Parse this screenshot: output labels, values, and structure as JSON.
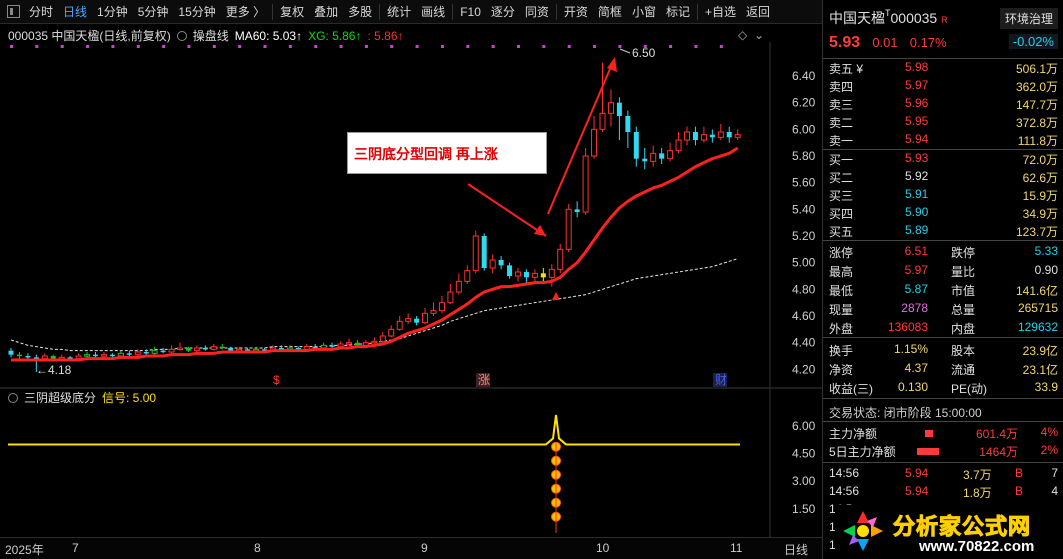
{
  "toolbar": {
    "items": [
      "分时",
      "日线",
      "1分钟",
      "5分钟",
      "15分钟",
      "更多 〉",
      "复权",
      "叠加",
      "多股",
      "统计",
      "画线",
      "F10",
      "逐分",
      "同资",
      "开资",
      "简框",
      "小窗",
      "标记",
      "+自选",
      "返回"
    ],
    "active_index": 1
  },
  "chart": {
    "title": "000035 中国天楹(日线,前复权)",
    "indicator_name": "操盘线",
    "ma60_label": "MA60: 5.03↑",
    "xg_label": "XG: 5.86↑",
    "third_label": ": 5.86↑",
    "high_marker": "6.50",
    "low_marker": "4.18",
    "annotation": "三阴底分型回调 再上涨",
    "y_ticks": [
      "6.40",
      "6.20",
      "6.00",
      "5.80",
      "5.60",
      "5.40",
      "5.20",
      "5.00",
      "4.80",
      "4.60",
      "4.40",
      "4.20"
    ],
    "event_marks": [
      "$",
      "涨",
      "财"
    ],
    "sub_title": "三阴超级底分",
    "sub_signal": "信号: 5.00",
    "sub_y_ticks": [
      "6.00",
      "4.50",
      "3.00",
      "1.50"
    ],
    "x_labels": [
      "2025年",
      "7",
      "8",
      "9",
      "10",
      "11",
      "日线"
    ]
  },
  "chart_data": {
    "type": "candlestick",
    "ylim": [
      4.12,
      6.52
    ],
    "bars": [
      [
        4.34,
        4.31,
        4.36,
        4.29
      ],
      [
        4.31,
        4.3,
        4.33,
        4.28
      ],
      [
        4.3,
        4.29,
        4.32,
        4.27
      ],
      [
        4.29,
        4.28,
        4.31,
        4.18
      ],
      [
        4.28,
        4.3,
        4.32,
        4.26
      ],
      [
        4.3,
        4.28,
        4.31,
        4.27
      ],
      [
        4.28,
        4.29,
        4.31,
        4.27
      ],
      [
        4.29,
        4.28,
        4.3,
        4.26
      ],
      [
        4.28,
        4.3,
        4.32,
        4.27
      ],
      [
        4.3,
        4.31,
        4.33,
        4.29
      ],
      [
        4.31,
        4.3,
        4.33,
        4.29
      ],
      [
        4.3,
        4.31,
        4.33,
        4.29
      ],
      [
        4.31,
        4.3,
        4.32,
        4.28
      ],
      [
        4.3,
        4.32,
        4.34,
        4.29
      ],
      [
        4.32,
        4.31,
        4.34,
        4.3
      ],
      [
        4.31,
        4.33,
        4.35,
        4.3
      ],
      [
        4.33,
        4.32,
        4.35,
        4.31
      ],
      [
        4.32,
        4.34,
        4.37,
        4.31
      ],
      [
        4.34,
        4.33,
        4.36,
        4.32
      ],
      [
        4.33,
        4.35,
        4.38,
        4.32
      ],
      [
        4.35,
        4.36,
        4.4,
        4.34
      ],
      [
        4.36,
        4.34,
        4.37,
        4.33
      ],
      [
        4.34,
        4.36,
        4.38,
        4.33
      ],
      [
        4.36,
        4.35,
        4.38,
        4.34
      ],
      [
        4.35,
        4.37,
        4.39,
        4.34
      ],
      [
        4.37,
        4.36,
        4.39,
        4.35
      ],
      [
        4.36,
        4.34,
        4.37,
        4.33
      ],
      [
        4.34,
        4.35,
        4.37,
        4.33
      ],
      [
        4.35,
        4.34,
        4.36,
        4.32
      ],
      [
        4.34,
        4.35,
        4.37,
        4.33
      ],
      [
        4.35,
        4.34,
        4.36,
        4.33
      ],
      [
        4.34,
        4.36,
        4.38,
        4.33
      ],
      [
        4.36,
        4.35,
        4.38,
        4.34
      ],
      [
        4.35,
        4.36,
        4.38,
        4.34
      ],
      [
        4.36,
        4.35,
        4.37,
        4.34
      ],
      [
        4.35,
        4.37,
        4.39,
        4.34
      ],
      [
        4.37,
        4.36,
        4.39,
        4.35
      ],
      [
        4.36,
        4.38,
        4.4,
        4.35
      ],
      [
        4.38,
        4.37,
        4.4,
        4.36
      ],
      [
        4.37,
        4.39,
        4.41,
        4.36
      ],
      [
        4.39,
        4.4,
        4.43,
        4.38
      ],
      [
        4.4,
        4.38,
        4.42,
        4.37
      ],
      [
        4.38,
        4.4,
        4.42,
        4.37
      ],
      [
        4.4,
        4.41,
        4.44,
        4.39
      ],
      [
        4.41,
        4.45,
        4.48,
        4.4
      ],
      [
        4.45,
        4.5,
        4.53,
        4.44
      ],
      [
        4.5,
        4.56,
        4.6,
        4.49
      ],
      [
        4.56,
        4.58,
        4.62,
        4.54
      ],
      [
        4.58,
        4.55,
        4.6,
        4.53
      ],
      [
        4.55,
        4.62,
        4.66,
        4.54
      ],
      [
        4.62,
        4.64,
        4.7,
        4.6
      ],
      [
        4.64,
        4.7,
        4.75,
        4.62
      ],
      [
        4.7,
        4.78,
        4.84,
        4.69
      ],
      [
        4.78,
        4.86,
        4.92,
        4.76
      ],
      [
        4.86,
        4.94,
        4.98,
        4.84
      ],
      [
        4.94,
        5.2,
        5.24,
        4.92
      ],
      [
        5.2,
        4.96,
        5.22,
        4.94
      ],
      [
        4.96,
        5.02,
        5.06,
        4.92
      ],
      [
        5.02,
        4.98,
        5.05,
        4.95
      ],
      [
        4.98,
        4.9,
        5.0,
        4.88
      ],
      [
        4.9,
        4.93,
        4.96,
        4.86
      ],
      [
        4.93,
        4.89,
        4.95,
        4.84
      ],
      [
        4.89,
        4.92,
        4.95,
        4.85
      ],
      [
        4.92,
        4.89,
        4.96,
        4.86
      ],
      [
        4.89,
        4.95,
        4.99,
        4.82
      ],
      [
        4.95,
        5.1,
        5.14,
        4.92
      ],
      [
        5.1,
        5.4,
        5.44,
        5.08
      ],
      [
        5.4,
        5.38,
        5.46,
        5.34
      ],
      [
        5.38,
        5.8,
        5.86,
        5.36
      ],
      [
        5.8,
        6.0,
        6.1,
        5.78
      ],
      [
        6.0,
        6.12,
        6.5,
        5.98
      ],
      [
        6.12,
        6.2,
        6.3,
        6.02
      ],
      [
        6.2,
        6.1,
        6.24,
        5.92
      ],
      [
        6.1,
        5.98,
        6.14,
        5.86
      ],
      [
        5.98,
        5.78,
        6.02,
        5.72
      ],
      [
        5.78,
        5.76,
        5.86,
        5.7
      ],
      [
        5.76,
        5.82,
        5.88,
        5.72
      ],
      [
        5.82,
        5.78,
        5.86,
        5.74
      ],
      [
        5.78,
        5.84,
        5.9,
        5.76
      ],
      [
        5.84,
        5.92,
        5.98,
        5.82
      ],
      [
        5.92,
        5.98,
        6.02,
        5.88
      ],
      [
        5.98,
        5.92,
        6.02,
        5.88
      ],
      [
        5.92,
        5.96,
        6.02,
        5.9
      ],
      [
        5.96,
        5.94,
        6.0,
        5.9
      ],
      [
        5.94,
        5.98,
        6.04,
        5.92
      ],
      [
        5.98,
        5.94,
        6.02,
        5.9
      ],
      [
        5.94,
        5.96,
        6.0,
        5.92
      ]
    ],
    "red_line": [
      4.27,
      4.27,
      4.27,
      4.27,
      4.27,
      4.27,
      4.27,
      4.27,
      4.27,
      4.28,
      4.28,
      4.28,
      4.28,
      4.29,
      4.29,
      4.29,
      4.3,
      4.3,
      4.3,
      4.31,
      4.31,
      4.31,
      4.32,
      4.32,
      4.32,
      4.33,
      4.33,
      4.33,
      4.33,
      4.33,
      4.33,
      4.34,
      4.34,
      4.34,
      4.34,
      4.34,
      4.35,
      4.35,
      4.35,
      4.36,
      4.36,
      4.37,
      4.37,
      4.38,
      4.39,
      4.41,
      4.44,
      4.47,
      4.49,
      4.51,
      4.54,
      4.57,
      4.61,
      4.65,
      4.69,
      4.74,
      4.78,
      4.8,
      4.82,
      4.82,
      4.83,
      4.84,
      4.85,
      4.85,
      4.86,
      4.89,
      4.95,
      5.0,
      5.08,
      5.17,
      5.26,
      5.34,
      5.41,
      5.46,
      5.5,
      5.53,
      5.56,
      5.58,
      5.61,
      5.64,
      5.68,
      5.72,
      5.75,
      5.78,
      5.8,
      5.82,
      5.86
    ],
    "white_dashed": [
      4.42,
      4.4,
      4.38,
      4.37,
      4.36,
      4.35,
      4.35,
      4.34,
      4.34,
      4.34,
      4.34,
      4.34,
      4.34,
      4.34,
      4.34,
      4.34,
      4.34,
      4.35,
      4.35,
      4.35,
      4.36,
      4.36,
      4.36,
      4.36,
      4.36,
      4.36,
      4.36,
      4.36,
      4.36,
      4.36,
      4.36,
      4.37,
      4.37,
      4.37,
      4.37,
      4.37,
      4.37,
      4.37,
      4.38,
      4.38,
      4.38,
      4.39,
      4.39,
      4.4,
      4.41,
      4.42,
      4.43,
      4.45,
      4.47,
      4.49,
      4.51,
      4.53,
      4.56,
      4.58,
      4.6,
      4.62,
      4.64,
      4.65,
      4.66,
      4.67,
      4.68,
      4.69,
      4.7,
      4.71,
      4.72,
      4.73,
      4.74,
      4.75,
      4.76,
      4.78,
      4.8,
      4.82,
      4.84,
      4.86,
      4.88,
      4.89,
      4.9,
      4.91,
      4.92,
      4.93,
      4.94,
      4.95,
      4.96,
      4.97,
      4.99,
      5.01,
      5.03
    ],
    "sub_signal_value": 5.0,
    "sub_ylim": [
      0.4,
      7.2
    ]
  },
  "quote": {
    "name": "中国天楹",
    "code": "000035",
    "tag": "R",
    "sector": "环境治理",
    "price": "5.93",
    "change": "0.01",
    "pct": "0.17%",
    "sector_pct": "-0.02%",
    "asks": [
      [
        "卖五 ¥",
        "5.98",
        "506.1万"
      ],
      [
        "卖四",
        "5.97",
        "362.0万"
      ],
      [
        "卖三",
        "5.96",
        "147.7万"
      ],
      [
        "卖二",
        "5.95",
        "372.8万"
      ],
      [
        "卖一",
        "5.94",
        "111.8万"
      ]
    ],
    "bids": [
      [
        "买一",
        "5.93",
        "72.0万"
      ],
      [
        "买二",
        "5.92",
        "62.6万"
      ],
      [
        "买三",
        "5.91",
        "15.9万"
      ],
      [
        "买四",
        "5.90",
        "34.9万"
      ],
      [
        "买五",
        "5.89",
        "123.7万"
      ]
    ],
    "stats": [
      [
        "涨停",
        "6.51",
        "跌停",
        "5.33"
      ],
      [
        "最高",
        "5.97",
        "量比",
        "0.90"
      ],
      [
        "最低",
        "5.87",
        "市值",
        "141.6亿"
      ],
      [
        "现量",
        "2878",
        "总量",
        "265715"
      ],
      [
        "外盘",
        "136083",
        "内盘",
        "129632"
      ]
    ],
    "fin": [
      [
        "换手",
        "1.15%",
        "股本",
        "23.9亿"
      ],
      [
        "净资",
        "4.37",
        "流通",
        "23.1亿"
      ],
      [
        "收益(三)",
        "0.130",
        "PE(动)",
        "33.9"
      ]
    ],
    "trade_status": "交易状态: 闭市阶段 15:00:00",
    "flows": [
      [
        "主力净额",
        "601.4万",
        "4%"
      ],
      [
        "5日主力净额",
        "1464万",
        "2%"
      ]
    ],
    "ticks": [
      [
        "14:56",
        "5.94",
        "3.7万",
        "B",
        "7"
      ],
      [
        "14:56",
        "5.94",
        "1.8万",
        "B",
        "4"
      ],
      [
        "14:5",
        "",
        "",
        "",
        ""
      ],
      [
        "14:5",
        "",
        "",
        "",
        ""
      ],
      [
        "14:5",
        "",
        "",
        "",
        ""
      ]
    ],
    "watermark": "分析家公式网",
    "watermark_url": "www.70822.com"
  }
}
